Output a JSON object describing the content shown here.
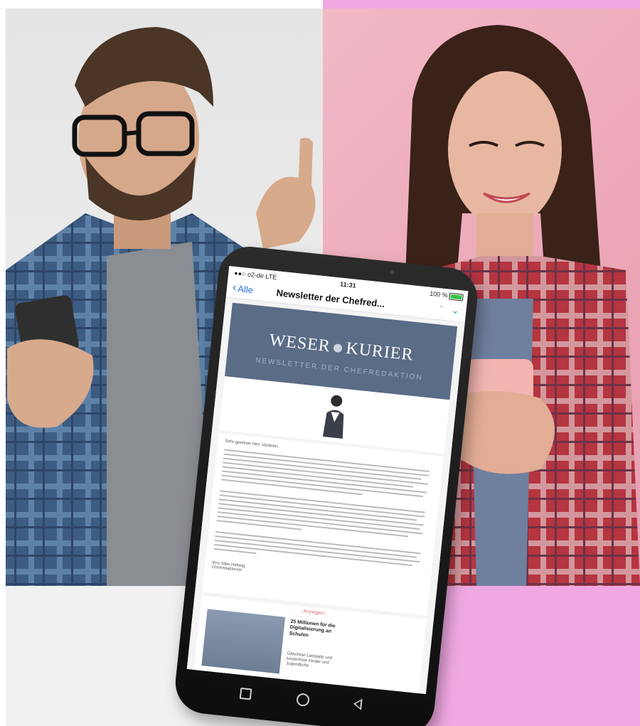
{
  "phone": {
    "status": {
      "carrier": "●●○ o2-de  LTE",
      "time": "11:31",
      "battery": "100 %"
    },
    "nav": {
      "back_label": "Alle",
      "title": "Newsletter der Chefred...",
      "back_icon": "chevron-left-icon",
      "up_icon": "chevron-up-icon",
      "down_icon": "chevron-down-icon"
    },
    "banner": {
      "logo_left": "WESER",
      "logo_right": "KURIER",
      "subtitle": "NEWSLETTER DER CHEFREDAKTION"
    },
    "email": {
      "salutation": "Sehr geehrter Herr Verdeter,",
      "signature": "Ihre Silke Hellwig\nChefredakteurin"
    },
    "promo": {
      "label": "- Anzeigen -",
      "title": "25 Millionen für die Digitalisierung an Schulen",
      "text": "Gleichviel Leitstätte und kostenfreie Kinder und Jugendliche"
    }
  },
  "colors": {
    "right_panel": "#f0a8e2",
    "banner": "#5a6c86",
    "link_blue": "#2a72d9"
  }
}
